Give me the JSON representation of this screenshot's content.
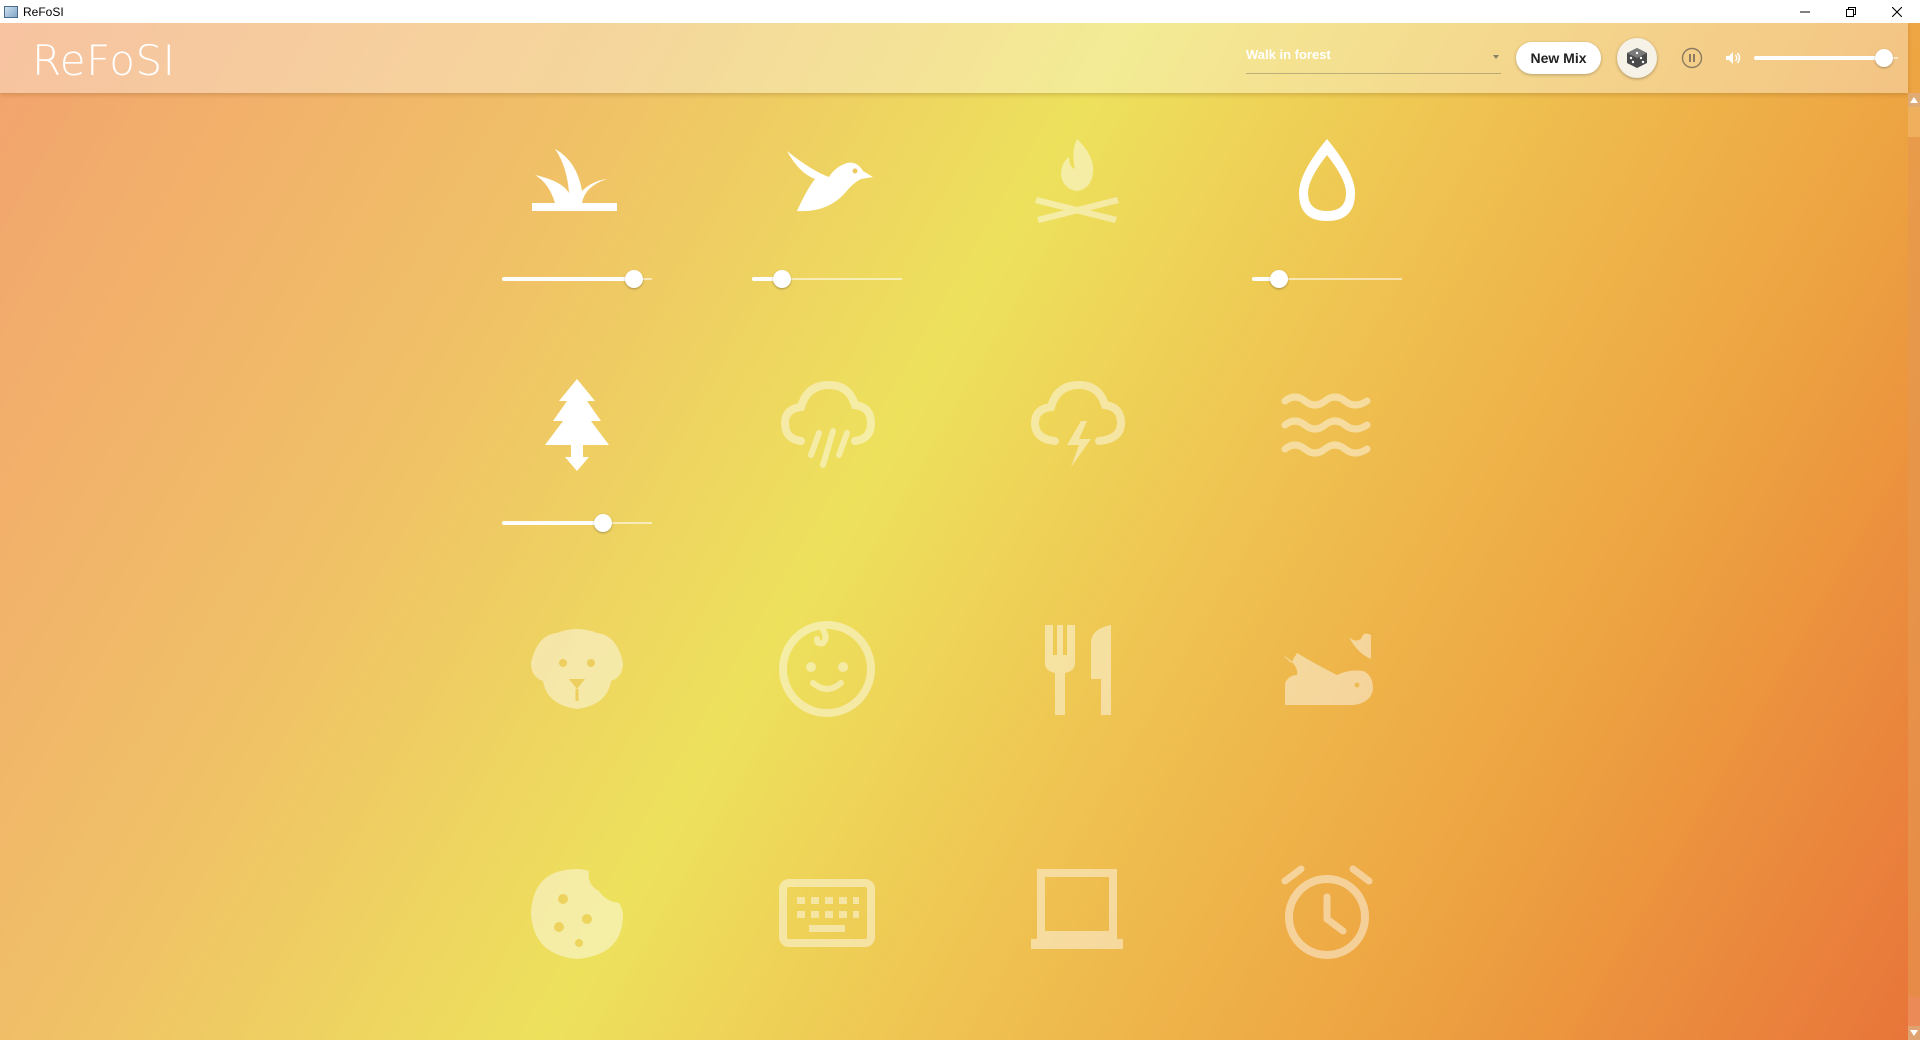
{
  "window": {
    "title": "ReFoSI",
    "controls": {
      "minimize_icon": "minimize-icon",
      "maximize_icon": "restore-icon",
      "close_icon": "close-icon"
    }
  },
  "header": {
    "app_title": "ReFoSI",
    "mix_select": {
      "value": "Walk in forest",
      "icon": "chevron-down-icon"
    },
    "new_mix_label": "New Mix",
    "random_icon": "dice-icon",
    "pause_icon": "pause-icon",
    "volume_icon": "speaker-icon",
    "master_volume": 0.9
  },
  "colors": {
    "gradient": [
      "#f3a36e",
      "#f0c067",
      "#ede15c",
      "#efc452",
      "#eda040",
      "#e8743a"
    ],
    "icon_active": "#ffffff",
    "icon_inactive": "rgba(255,255,255,0.45)"
  },
  "sounds": [
    {
      "name": "grass",
      "icon": "grass-icon",
      "active": true,
      "volume": 0.88
    },
    {
      "name": "bird",
      "icon": "bird-icon",
      "active": true,
      "volume": 0.2
    },
    {
      "name": "campfire",
      "icon": "campfire-icon",
      "active": false,
      "volume": null
    },
    {
      "name": "water-drop",
      "icon": "water-drop-icon",
      "active": true,
      "volume": 0.18
    },
    {
      "name": "forest",
      "icon": "pine-tree-icon",
      "active": true,
      "volume": 0.67
    },
    {
      "name": "rain",
      "icon": "rain-cloud-icon",
      "active": false,
      "volume": null
    },
    {
      "name": "thunder",
      "icon": "storm-cloud-icon",
      "active": false,
      "volume": null
    },
    {
      "name": "waves",
      "icon": "waves-icon",
      "active": false,
      "volume": null
    },
    {
      "name": "dog",
      "icon": "dog-icon",
      "active": false,
      "volume": null
    },
    {
      "name": "baby",
      "icon": "baby-face-icon",
      "active": false,
      "volume": null
    },
    {
      "name": "restaurant",
      "icon": "fork-knife-icon",
      "active": false,
      "volume": null
    },
    {
      "name": "whale",
      "icon": "whale-icon",
      "active": false,
      "volume": null
    },
    {
      "name": "cookie",
      "icon": "cookie-icon",
      "active": false,
      "volume": null
    },
    {
      "name": "keyboard",
      "icon": "keyboard-icon",
      "active": false,
      "volume": null
    },
    {
      "name": "laptop",
      "icon": "laptop-icon",
      "active": false,
      "volume": null
    },
    {
      "name": "alarm-clock",
      "icon": "alarm-clock-icon",
      "active": false,
      "volume": null
    }
  ]
}
